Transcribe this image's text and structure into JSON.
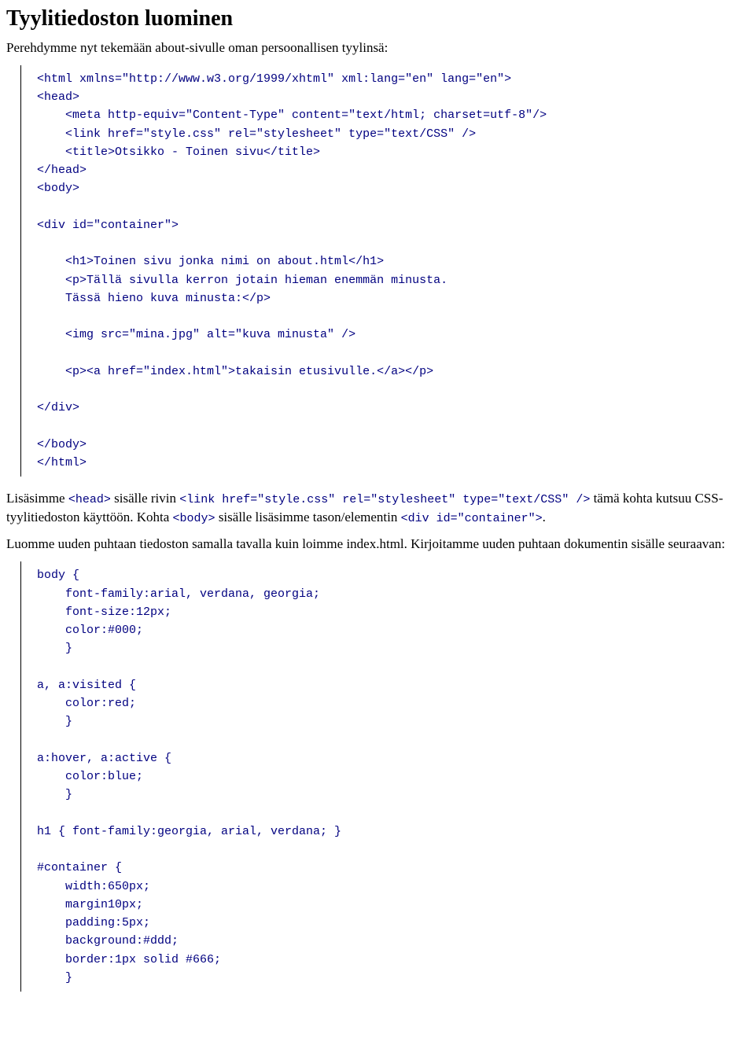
{
  "title": "Tyylitiedoston luominen",
  "intro": "Perehdymme nyt tekemään about-sivulle oman persoonallisen tyylinsä:",
  "code1": "<html xmlns=\"http://www.w3.org/1999/xhtml\" xml:lang=\"en\" lang=\"en\">\n<head>\n    <meta http-equiv=\"Content-Type\" content=\"text/html; charset=utf-8\"/>\n    <link href=\"style.css\" rel=\"stylesheet\" type=\"text/CSS\" />\n    <title>Otsikko - Toinen sivu</title>\n</head>\n<body>\n\n<div id=\"container\">\n\n    <h1>Toinen sivu jonka nimi on about.html</h1>\n    <p>Tällä sivulla kerron jotain hieman enemmän minusta.\n    Tässä hieno kuva minusta:</p>\n\n    <img src=\"mina.jpg\" alt=\"kuva minusta\" />\n\n    <p><a href=\"index.html\">takaisin etusivulle.</a></p>\n\n</div>\n\n</body>\n</html>",
  "para2": {
    "t1": "Lisäsimme ",
    "c1": "<head>",
    "t2": " sisälle rivin ",
    "c2": "<link href=\"style.css\" rel=\"stylesheet\" type=\"text/CSS\" />",
    "t3": " tämä kohta kutsuu CSS-tyylitiedoston käyttöön. Kohta ",
    "c3": "<body>",
    "t4": " sisälle lisäsimme tason/elementin ",
    "c4": "<div id=\"container\">",
    "t5": "."
  },
  "para3": "Luomme uuden puhtaan tiedoston samalla tavalla kuin loimme index.html. Kirjoitamme uuden puhtaan dokumentin sisälle seuraavan:",
  "code2": "body {\n    font-family:arial, verdana, georgia;\n    font-size:12px;\n    color:#000;\n    }\n\na, a:visited {\n    color:red;\n    }\n\na:hover, a:active {\n    color:blue;\n    }\n\nh1 { font-family:georgia, arial, verdana; }\n\n#container {\n    width:650px;\n    margin10px;\n    padding:5px;\n    background:#ddd;\n    border:1px solid #666;\n    }"
}
